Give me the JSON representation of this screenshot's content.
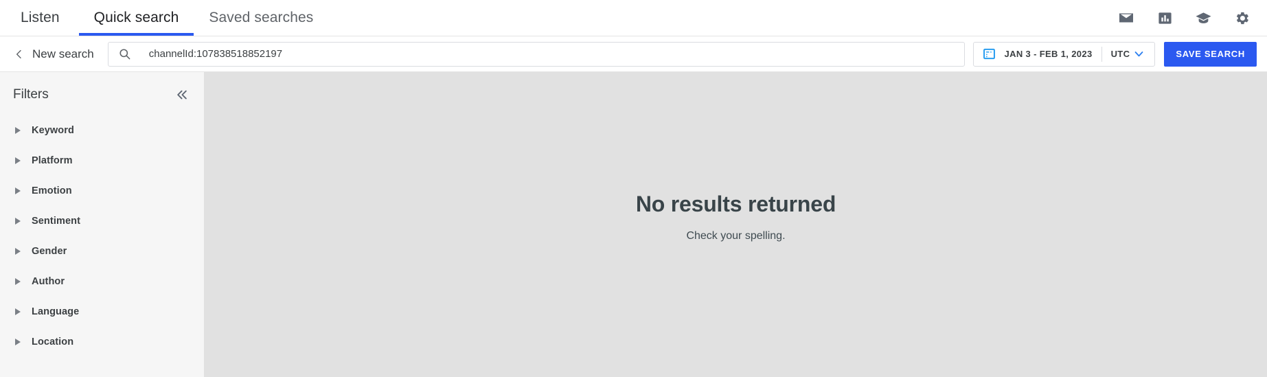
{
  "header": {
    "brand": "Listen",
    "tabs": [
      {
        "label": "Quick search",
        "active": true
      },
      {
        "label": "Saved searches",
        "active": false
      }
    ],
    "icons": [
      {
        "name": "mail-icon",
        "title": "Mail"
      },
      {
        "name": "bar-chart-icon",
        "title": "Reports"
      },
      {
        "name": "graduation-cap-icon",
        "title": "Academy"
      },
      {
        "name": "gear-icon",
        "title": "Settings"
      }
    ],
    "accent_color": "#2b59f0",
    "active_tab_underline_color": "#2b59f0"
  },
  "search": {
    "back_label": "New search",
    "query_value": "channelId:107838518852197",
    "placeholder": "Search",
    "date_range": "JAN 3 - FEB 1, 2023",
    "timezone": "UTC",
    "save_label": "SAVE SEARCH",
    "save_button_color": "#2b59f0",
    "calendar_icon_color": "#2b9ef0"
  },
  "sidebar": {
    "title": "Filters",
    "collapse_icon": "double-chevron-left-icon",
    "items": [
      {
        "label": "Keyword"
      },
      {
        "label": "Platform"
      },
      {
        "label": "Emotion"
      },
      {
        "label": "Sentiment"
      },
      {
        "label": "Gender"
      },
      {
        "label": "Author"
      },
      {
        "label": "Language"
      },
      {
        "label": "Location"
      }
    ]
  },
  "main": {
    "empty_title": "No results returned",
    "empty_subtitle": "Check your spelling.",
    "background_color": "#e1e1e1"
  }
}
